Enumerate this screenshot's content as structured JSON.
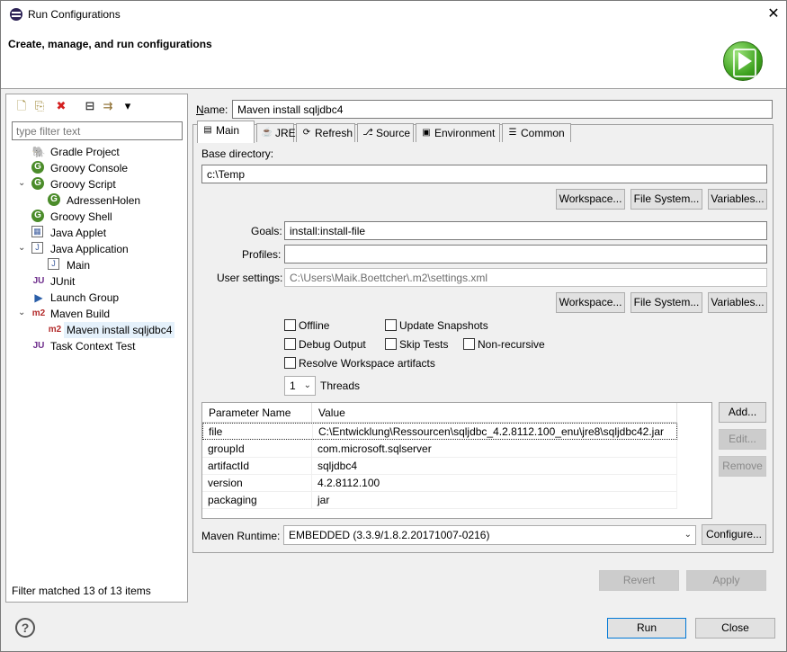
{
  "window": {
    "title": "Run Configurations",
    "close_glyph": "✕"
  },
  "banner": {
    "title": "Create, manage, and run configurations"
  },
  "left": {
    "toolbar": [
      {
        "name": "new-config-icon",
        "glyph": "🗋"
      },
      {
        "name": "duplicate-icon",
        "glyph": "⎘"
      },
      {
        "name": "delete-icon",
        "glyph": "✖"
      },
      {
        "name": "collapse-all-icon",
        "glyph": "⊟"
      },
      {
        "name": "filter-icon",
        "glyph": "⇉"
      },
      {
        "name": "view-menu-icon",
        "glyph": "▾"
      }
    ],
    "filter_placeholder": "type filter text",
    "tree": [
      {
        "label": "Gradle Project",
        "level": 0,
        "expander": "",
        "icon": "gradle",
        "glyph": "🐘"
      },
      {
        "label": "Groovy Console",
        "level": 0,
        "expander": "",
        "icon": "groovy",
        "glyph": "G"
      },
      {
        "label": "Groovy Script",
        "level": 0,
        "expander": "⌄",
        "icon": "groovy",
        "glyph": "G"
      },
      {
        "label": "AdressenHolen",
        "level": 1,
        "expander": "",
        "icon": "groovy",
        "glyph": "G"
      },
      {
        "label": "Groovy Shell",
        "level": 0,
        "expander": "",
        "icon": "groovy",
        "glyph": "G"
      },
      {
        "label": "Java Applet",
        "level": 0,
        "expander": "",
        "icon": "java",
        "glyph": "▦"
      },
      {
        "label": "Java Application",
        "level": 0,
        "expander": "⌄",
        "icon": "java",
        "glyph": "J"
      },
      {
        "label": "Main",
        "level": 1,
        "expander": "",
        "icon": "java",
        "glyph": "J"
      },
      {
        "label": "JUnit",
        "level": 0,
        "expander": "",
        "icon": "junit",
        "glyph": "JU"
      },
      {
        "label": "Launch Group",
        "level": 0,
        "expander": "",
        "icon": "launch",
        "glyph": "▶"
      },
      {
        "label": "Maven Build",
        "level": 0,
        "expander": "⌄",
        "icon": "m2",
        "glyph": "m2"
      },
      {
        "label": "Maven install sqljdbc4",
        "level": 1,
        "expander": "",
        "icon": "m2",
        "glyph": "m2",
        "selected": true
      },
      {
        "label": "Task Context Test",
        "level": 0,
        "expander": "",
        "icon": "junit",
        "glyph": "JU"
      }
    ],
    "filter_status": "Filter matched 13 of 13 items"
  },
  "config": {
    "name_label": "Name:",
    "name_value": "Maven install sqljdbc4",
    "tabs": [
      {
        "label": "Main",
        "glyph": "▤",
        "active": true
      },
      {
        "label": "JRE",
        "glyph": "☕"
      },
      {
        "label": "Refresh",
        "glyph": "⟳"
      },
      {
        "label": "Source",
        "glyph": "⎇"
      },
      {
        "label": "Environment",
        "glyph": "▣"
      },
      {
        "label": "Common",
        "glyph": "☰"
      }
    ],
    "base_dir_label": "Base directory:",
    "base_dir_value": "c:\\Temp",
    "workspace_btn": "Workspace...",
    "filesystem_btn": "File System...",
    "variables_btn": "Variables...",
    "goals_label": "Goals:",
    "goals_value": "install:install-file",
    "profiles_label": "Profiles:",
    "profiles_value": "",
    "user_settings_label": "User settings:",
    "user_settings_value": "C:\\Users\\Maik.Boettcher\\.m2\\settings.xml",
    "checkboxes": {
      "offline": "Offline",
      "update_snapshots": "Update Snapshots",
      "debug_output": "Debug Output",
      "skip_tests": "Skip Tests",
      "non_recursive": "Non-recursive",
      "resolve_workspace": "Resolve Workspace artifacts"
    },
    "threads_value": "1",
    "threads_label": "Threads",
    "table": {
      "headers": [
        "Parameter Name",
        "Value"
      ],
      "rows": [
        [
          "file",
          "C:\\Entwicklung\\Ressourcen\\sqljdbc_4.2.8112.100_enu\\jre8\\sqljdbc42.jar"
        ],
        [
          "groupId",
          "com.microsoft.sqlserver"
        ],
        [
          "artifactId",
          "sqljdbc4"
        ],
        [
          "version",
          "4.2.8112.100"
        ],
        [
          "packaging",
          "jar"
        ]
      ]
    },
    "add_btn": "Add...",
    "edit_btn": "Edit...",
    "remove_btn": "Remove",
    "runtime_label": "Maven Runtime:",
    "runtime_value": "EMBEDDED (3.3.9/1.8.2.20171007-0216)",
    "configure_btn": "Configure...",
    "revert_btn": "Revert",
    "apply_btn": "Apply"
  },
  "footer": {
    "help_glyph": "?",
    "run_btn": "Run",
    "close_btn": "Close"
  }
}
